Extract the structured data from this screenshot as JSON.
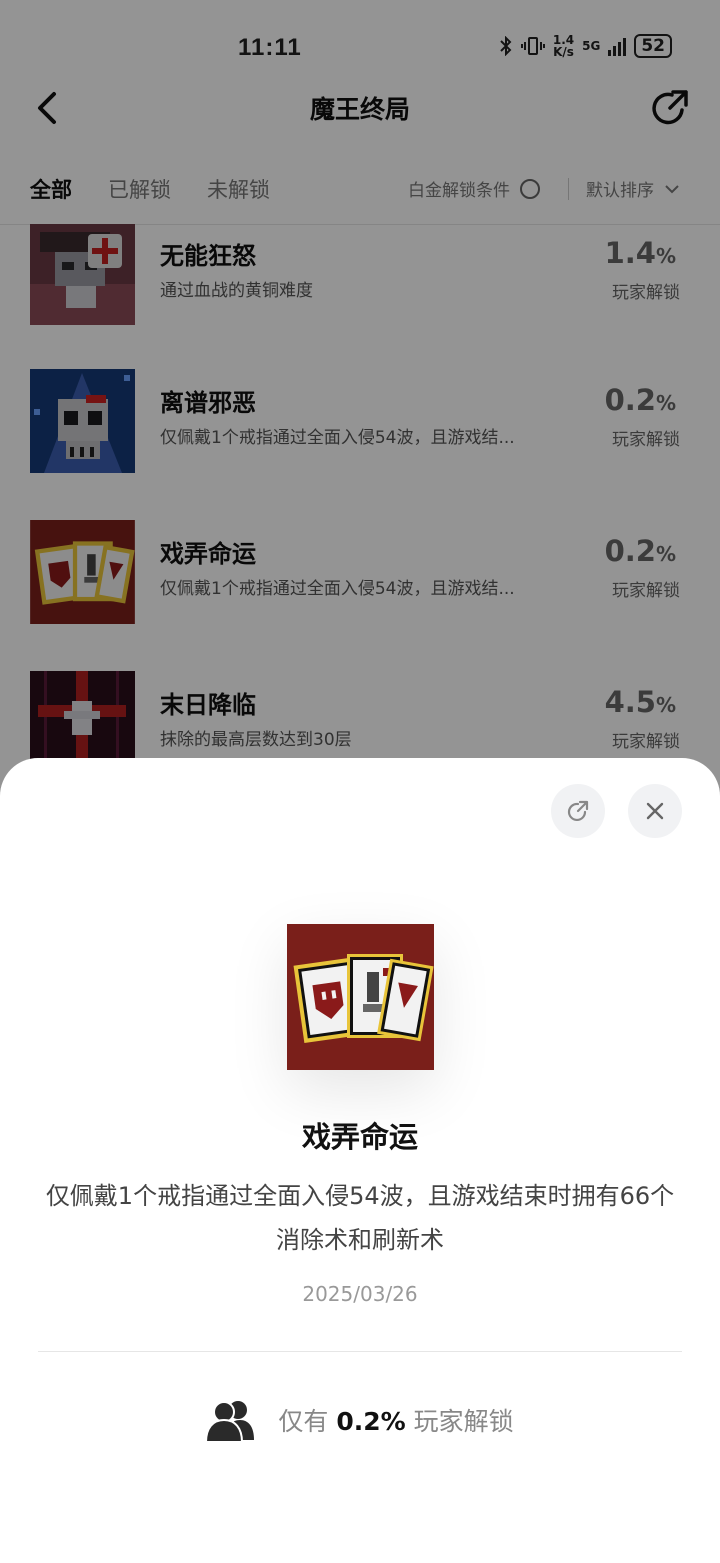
{
  "status": {
    "time": "11:11",
    "net_speed_top": "1.4",
    "net_speed_bottom": "K/s",
    "network": "5G",
    "battery": "52"
  },
  "nav": {
    "title": "魔王终局",
    "back_icon": "chevron-left-icon",
    "share_icon": "share-icon"
  },
  "tabs": [
    {
      "label": "全部",
      "active": true
    },
    {
      "label": "已解锁",
      "active": false
    },
    {
      "label": "未解锁",
      "active": false
    }
  ],
  "filter": {
    "platinum_label": "白金解锁条件",
    "sort_label": "默认排序"
  },
  "achievements": [
    {
      "name": "无能狂怒",
      "desc": "通过血战的黄铜难度",
      "pct": "1.4",
      "pct_unit": "%",
      "pct_label": "玩家解锁"
    },
    {
      "name": "离谱邪恶",
      "desc": "仅佩戴1个戒指通过全面入侵54波，且游戏结...",
      "pct": "0.2",
      "pct_unit": "%",
      "pct_label": "玩家解锁"
    },
    {
      "name": "戏弄命运",
      "desc": "仅佩戴1个戒指通过全面入侵54波，且游戏结...",
      "pct": "0.2",
      "pct_unit": "%",
      "pct_label": "玩家解锁"
    },
    {
      "name": "末日降临",
      "desc": "抹除的最高层数达到30层",
      "pct": "4.5",
      "pct_unit": "%",
      "pct_label": "玩家解锁"
    }
  ],
  "sheet": {
    "title": "戏弄命运",
    "desc": "仅佩戴1个戒指通过全面入侵54波，且游戏结束时拥有66个消除术和刷新术",
    "date": "2025/03/26",
    "stat_prefix": "仅有",
    "stat_value": "0.2%",
    "stat_suffix": "玩家解锁"
  },
  "colors": {
    "dim_overlay": "#000000",
    "card_red": "#7a1f1a",
    "card_gold": "#e8c43a"
  }
}
